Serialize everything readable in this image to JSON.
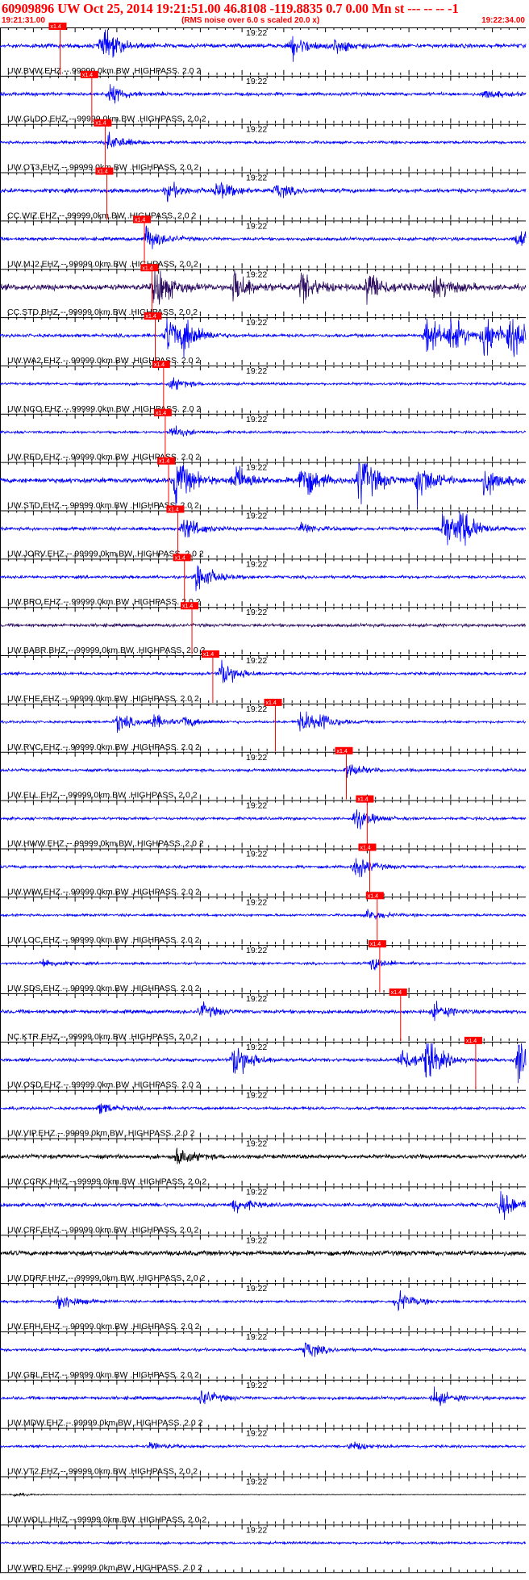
{
  "header": {
    "title": "60909896 UW Oct 25, 2014 19:21:51.00   46.8108 -119.8835  0.7 0.00 Mn st --- -- --  -1",
    "start_time": "19:21:31.00",
    "scale_note": "(RMS noise over 6.0 s scaled 20.0 x)",
    "end_time": "19:22:34.00"
  },
  "colors": {
    "trace_short_period": "#0000ff",
    "trace_broadband": "#2a0a5e",
    "trace_black": "#000000",
    "pick": "#ff0000",
    "text": "#ff0000"
  },
  "chart_data": {
    "type": "line",
    "x_unit": "time",
    "x_range": [
      "19:21:31.00",
      "19:22:34.00"
    ],
    "trace_time_label": "19:22",
    "pick_label": "x1.4",
    "traces": [
      {
        "label": "UW.BVW.EHZ.--.99999.0km.BW .HIGHPASS. 2.0  2",
        "pick": "19:21:38.2",
        "color": "blue",
        "amp": 0.5,
        "events": [
          [
            12,
            1.2
          ],
          [
            12.8,
            0.8
          ],
          [
            35,
            1.3
          ],
          [
            40,
            0.8
          ]
        ]
      },
      {
        "label": "UW.GLDO.EHZ.--.99999.0km.BW .HIGHPASS. 2.0  2",
        "pick": "19:21:42.0",
        "color": "blue",
        "amp": 0.4,
        "events": [
          [
            13,
            1.4
          ],
          [
            58,
            0.7
          ]
        ]
      },
      {
        "label": "UW.OT3.EHZ.--.99999.0km.BW .HIGHPASS. 2.0  2",
        "pick": "19:21:43.6",
        "color": "blue",
        "amp": 0.35,
        "events": [
          [
            13,
            1.6
          ]
        ]
      },
      {
        "label": "CC.WIZ.EHZ.--.99999.0km.BW .HIGHPASS. 2.0  2",
        "pick": "19:21:43.8",
        "color": "blue",
        "amp": 0.5,
        "events": [
          [
            20,
            0.9
          ],
          [
            26,
            1.1
          ],
          [
            33,
            0.8
          ]
        ]
      },
      {
        "label": "UW.MJ2.EHZ.--.99999.0km.BW .HIGHPASS. 2.0  2",
        "pick": "19:21:48.3",
        "color": "blue",
        "amp": 0.4,
        "events": [
          [
            17.5,
            1.8
          ],
          [
            62,
            1.5
          ]
        ]
      },
      {
        "label": "CC.STD.BHZ.--.99999.0km.BW .HIGHPASS. 2.0  2",
        "pick": "19:21:49.2",
        "color": "broadband",
        "amp": 0.7,
        "events": [
          [
            18.5,
            2.0
          ],
          [
            28,
            1.5
          ],
          [
            36,
            1.3
          ],
          [
            44,
            1.5
          ],
          [
            52,
            1.2
          ]
        ]
      },
      {
        "label": "UW.WA2.EHZ.--.99999.0km.BW .HIGHPASS. 2.0  2",
        "pick": "19:21:49.6",
        "color": "blue",
        "amp": 0.4,
        "events": [
          [
            20,
            3.0
          ],
          [
            22,
            2.0
          ],
          [
            51,
            3.2
          ],
          [
            54,
            2.6
          ],
          [
            58,
            3.4
          ],
          [
            61,
            3.4
          ]
        ]
      },
      {
        "label": "UW.NCO.EHZ.--.99999.0km.BW .HIGHPASS. 2.0  2",
        "pick": "19:21:50.6",
        "color": "blue",
        "amp": 0.3,
        "events": [
          [
            20.5,
            1.2
          ]
        ]
      },
      {
        "label": "UW.RED.EHZ.--.99999.0km.BW .HIGHPASS. 2.0  2",
        "pick": "19:21:50.8",
        "color": "blue",
        "amp": 0.3,
        "events": [
          [
            20.5,
            1.2
          ]
        ]
      },
      {
        "label": "UW.STD.EHZ.--.99999.0km.BW .HIGHPASS. 2.0  2",
        "pick": "19:21:51.2",
        "color": "blue",
        "amp": 0.6,
        "events": [
          [
            21,
            2.4
          ],
          [
            28,
            1.5
          ],
          [
            36,
            2.0
          ],
          [
            43,
            3.0
          ],
          [
            50,
            2.0
          ],
          [
            58,
            1.5
          ]
        ]
      },
      {
        "label": "UW.JORV.EHZ.--.99999.0km.BW .HIGHPASS. 2.0  2",
        "pick": "19:21:52.3",
        "color": "blue",
        "amp": 0.4,
        "events": [
          [
            22,
            1.8
          ],
          [
            36,
            0.8
          ],
          [
            53,
            3.0
          ],
          [
            55,
            2.4
          ]
        ]
      },
      {
        "label": "UW.BRO.EHZ.--.99999.0km.BW .HIGHPASS. 2.0  2",
        "pick": "19:21:53.1",
        "color": "blue",
        "amp": 0.35,
        "events": [
          [
            23.5,
            2.8
          ]
        ]
      },
      {
        "label": "UW.BABR.BHZ.--.99999.0km.BW .HIGHPASS. 2.0  2",
        "pick": "19:21:54.0",
        "color": "broadband",
        "amp": 0.4,
        "events": []
      },
      {
        "label": "UW.FHE.EHZ.--.99999.0km.BW .HIGHPASS. 2.0  2",
        "pick": "19:21:56.5",
        "color": "blue",
        "amp": 0.35,
        "events": [
          [
            26.5,
            2.4
          ]
        ]
      },
      {
        "label": "UW.RVC.EHZ.--.99999.0km.BW .HIGHPASS. 2.0  2",
        "pick": "19:22:04.0",
        "color": "blue",
        "amp": 0.3,
        "events": [
          [
            14,
            1.8
          ],
          [
            18,
            1.5
          ],
          [
            22,
            1.0
          ],
          [
            36,
            2.2
          ],
          [
            38,
            1.6
          ]
        ]
      },
      {
        "label": "UW.ELL.EHZ.--.99999.0km.BW .HIGHPASS. 2.0  2",
        "pick": "19:22:12.5",
        "color": "blue",
        "amp": 0.35,
        "events": [
          [
            41.5,
            1.3
          ]
        ]
      },
      {
        "label": "UW.HWW.EHZ.--.99999.0km.BW .HIGHPASS. 2.0  2",
        "pick": "19:22:15.0",
        "color": "blue",
        "amp": 0.35,
        "events": [
          [
            42.5,
            1.8
          ]
        ]
      },
      {
        "label": "UW.WIW.EHZ.--.99999.0km.BW .HIGHPASS. 2.0  2",
        "pick": "19:22:15.3",
        "color": "blue",
        "amp": 0.35,
        "events": [
          [
            42.5,
            2.0
          ]
        ]
      },
      {
        "label": "UW.LOC.EHZ.--.99999.0km.BW .HIGHPASS. 2.0  2",
        "pick": "19:22:16.2",
        "color": "blue",
        "amp": 0.3,
        "events": [
          [
            44,
            1.2
          ]
        ]
      },
      {
        "label": "UW.SDS.EHZ.--.99999.0km.BW .HIGHPASS. 2.0  2",
        "pick": "19:22:16.5",
        "color": "blue",
        "amp": 0.3,
        "events": [
          [
            5,
            0.9
          ],
          [
            44.5,
            1.3
          ]
        ]
      },
      {
        "label": "NC.KTR.EHZ.--.99999.0km.BW .HIGHPASS. 2.0  2",
        "pick": "19:22:19.0",
        "color": "blue",
        "amp": 0.45,
        "events": [
          [
            24,
            1.0
          ],
          [
            52,
            1.0
          ]
        ]
      },
      {
        "label": "UW.OSD.EHZ.--.99999.0km.BW .HIGHPASS. 2.0  2",
        "pick": "19:22:28.0",
        "color": "blue",
        "amp": 0.4,
        "events": [
          [
            28,
            3.0
          ],
          [
            48,
            2.0
          ],
          [
            51,
            3.0
          ],
          [
            62,
            3.4
          ]
        ]
      },
      {
        "label": "UW.VIP.EHZ.--.99999.0km.BW .HIGHPASS. 2.0  2",
        "pick": null,
        "color": "blue",
        "amp": 0.35,
        "events": [
          [
            12,
            1.0
          ]
        ]
      },
      {
        "label": "UW.CCRK.HHZ.--.99999.0km.BW .HIGHPASS. 2.0  2",
        "pick": null,
        "color": "black",
        "amp": 0.5,
        "events": [
          [
            21,
            1.2
          ]
        ]
      },
      {
        "label": "UW.CRF.EHZ.--.99999.0km.BW .HIGHPASS. 2.0  2",
        "pick": null,
        "color": "blue",
        "amp": 0.45,
        "events": [
          [
            28,
            1.0
          ],
          [
            60,
            1.8
          ]
        ]
      },
      {
        "label": "UW.DDRF.HHZ.--.99999.0km.BW .HIGHPASS. 2.0  2",
        "pick": null,
        "color": "black",
        "amp": 0.6,
        "events": []
      },
      {
        "label": "UW.EPH.EHZ.--.99999.0km.BW .HIGHPASS. 2.0  2",
        "pick": null,
        "color": "blue",
        "amp": 0.3,
        "events": [
          [
            7,
            2.0
          ],
          [
            47.5,
            2.2
          ]
        ]
      },
      {
        "label": "UW.GBL.EHZ.--.99999.0km.BW .HIGHPASS. 2.0  2",
        "pick": null,
        "color": "blue",
        "amp": 0.35,
        "events": [
          [
            36.5,
            1.5
          ]
        ]
      },
      {
        "label": "UW.MDW.EHZ.--.99999.0km.BW .HIGHPASS. 2.0  2",
        "pick": null,
        "color": "blue",
        "amp": 0.4,
        "events": [
          [
            24,
            1.2
          ],
          [
            52,
            1.2
          ]
        ]
      },
      {
        "label": "UW.VT2.EHZ.--.99999.0km.BW .HIGHPASS. 2.0  2",
        "pick": null,
        "color": "blue",
        "amp": 0.3,
        "events": [
          [
            18,
            0.8
          ],
          [
            42,
            0.9
          ]
        ]
      },
      {
        "label": "UW.WOLL.HHZ.--.99999.0km.BW .HIGHPASS. 2.0  2",
        "pick": null,
        "color": "black",
        "amp": 0.1,
        "events": [
          [
            1.5,
            1.2
          ]
        ]
      },
      {
        "label": "UW.WRD.EHZ.--.99999.0km.BW .HIGHPASS. 2.0  2",
        "pick": null,
        "color": "blue",
        "amp": 0.3,
        "events": []
      }
    ]
  }
}
